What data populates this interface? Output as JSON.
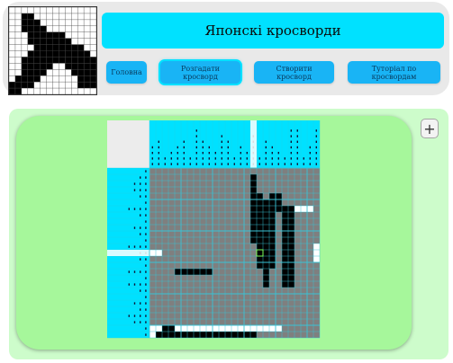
{
  "header": {
    "title": "Японскі кросворди",
    "logo_icon": "cat-nonogram-logo"
  },
  "nav": [
    {
      "label": "Головна"
    },
    {
      "label": "Розгадати кросворд",
      "active": true
    },
    {
      "label": "Створити кросворд"
    },
    {
      "label": "Туторіал по кросвордам"
    }
  ],
  "toolbar": {
    "add_label": "+"
  },
  "puzzle": {
    "grid_cols": 27,
    "grid_rows": 27,
    "filled_cells": [
      [
        4,
        16
      ],
      [
        5,
        16
      ],
      [
        6,
        16
      ],
      [
        7,
        16
      ],
      [
        8,
        16
      ],
      [
        9,
        16
      ],
      [
        1,
        26
      ],
      [
        2,
        26
      ],
      [
        3,
        26
      ],
      [
        4,
        26
      ],
      [
        5,
        26
      ],
      [
        6,
        26
      ],
      [
        7,
        26
      ],
      [
        8,
        26
      ],
      [
        9,
        26
      ],
      [
        10,
        26
      ],
      [
        11,
        26
      ],
      [
        12,
        26
      ],
      [
        13,
        26
      ],
      [
        14,
        26
      ],
      [
        15,
        26
      ],
      [
        16,
        26
      ],
      [
        2,
        25
      ],
      [
        3,
        25
      ],
      [
        16,
        1
      ],
      [
        16,
        2
      ],
      [
        16,
        3
      ],
      [
        16,
        4
      ],
      [
        16,
        5
      ],
      [
        16,
        6
      ],
      [
        16,
        7
      ],
      [
        16,
        8
      ],
      [
        16,
        9
      ],
      [
        16,
        10
      ],
      [
        16,
        11
      ],
      [
        17,
        4
      ],
      [
        17,
        5
      ],
      [
        17,
        6
      ],
      [
        17,
        7
      ],
      [
        17,
        8
      ],
      [
        17,
        9
      ],
      [
        17,
        10
      ],
      [
        17,
        11
      ],
      [
        17,
        12
      ],
      [
        17,
        13
      ],
      [
        17,
        14
      ],
      [
        17,
        15
      ],
      [
        18,
        5
      ],
      [
        18,
        6
      ],
      [
        18,
        7
      ],
      [
        18,
        8
      ],
      [
        18,
        9
      ],
      [
        18,
        10
      ],
      [
        18,
        11
      ],
      [
        18,
        12
      ],
      [
        18,
        13
      ],
      [
        18,
        14
      ],
      [
        18,
        15
      ],
      [
        18,
        16
      ],
      [
        18,
        17
      ],
      [
        18,
        18
      ],
      [
        19,
        4
      ],
      [
        19,
        5
      ],
      [
        19,
        6
      ],
      [
        19,
        7
      ],
      [
        19,
        8
      ],
      [
        19,
        9
      ],
      [
        19,
        10
      ],
      [
        19,
        11
      ],
      [
        19,
        12
      ],
      [
        19,
        13
      ],
      [
        19,
        14
      ],
      [
        19,
        15
      ],
      [
        20,
        4
      ],
      [
        20,
        5
      ],
      [
        20,
        6
      ],
      [
        21,
        6
      ],
      [
        21,
        7
      ],
      [
        21,
        8
      ],
      [
        21,
        9
      ],
      [
        21,
        10
      ],
      [
        21,
        11
      ],
      [
        21,
        12
      ],
      [
        21,
        13
      ],
      [
        21,
        14
      ],
      [
        21,
        15
      ],
      [
        21,
        16
      ],
      [
        21,
        17
      ],
      [
        21,
        18
      ],
      [
        22,
        6
      ],
      [
        22,
        7
      ],
      [
        22,
        8
      ],
      [
        22,
        9
      ],
      [
        22,
        10
      ],
      [
        22,
        11
      ],
      [
        22,
        12
      ],
      [
        22,
        13
      ],
      [
        22,
        14
      ],
      [
        22,
        15
      ],
      [
        22,
        16
      ],
      [
        22,
        17
      ],
      [
        22,
        18
      ]
    ],
    "crossed_cells": [
      [
        0,
        13
      ],
      [
        1,
        13
      ],
      [
        23,
        6
      ],
      [
        24,
        6
      ],
      [
        25,
        6
      ],
      [
        0,
        26
      ],
      [
        1,
        26
      ],
      [
        2,
        26
      ],
      [
        3,
        26
      ],
      [
        4,
        26
      ],
      [
        5,
        26
      ],
      [
        6,
        26
      ],
      [
        7,
        26
      ],
      [
        8,
        26
      ],
      [
        9,
        26
      ],
      [
        10,
        26
      ],
      [
        11,
        26
      ],
      [
        12,
        26
      ],
      [
        13,
        26
      ],
      [
        14,
        26
      ],
      [
        15,
        26
      ],
      [
        0,
        25
      ],
      [
        1,
        25
      ],
      [
        2,
        25
      ],
      [
        3,
        25
      ],
      [
        4,
        25
      ],
      [
        5,
        25
      ],
      [
        6,
        25
      ],
      [
        7,
        25
      ],
      [
        8,
        25
      ],
      [
        9,
        25
      ],
      [
        10,
        25
      ],
      [
        11,
        25
      ],
      [
        12,
        25
      ],
      [
        13,
        25
      ],
      [
        14,
        25
      ],
      [
        15,
        25
      ],
      [
        16,
        25
      ],
      [
        17,
        25
      ],
      [
        18,
        25
      ],
      [
        19,
        25
      ],
      [
        20,
        25
      ],
      [
        26,
        12
      ],
      [
        26,
        13
      ],
      [
        26,
        14
      ]
    ]
  },
  "colors": {
    "accent_cyan": "#00e1ff",
    "nav_blue": "#19b4f5",
    "board_green": "#a6f79b",
    "panel_green": "#cdfccb",
    "grid_gray": "#7f7f7f",
    "grid_line": "#39c3d6"
  }
}
